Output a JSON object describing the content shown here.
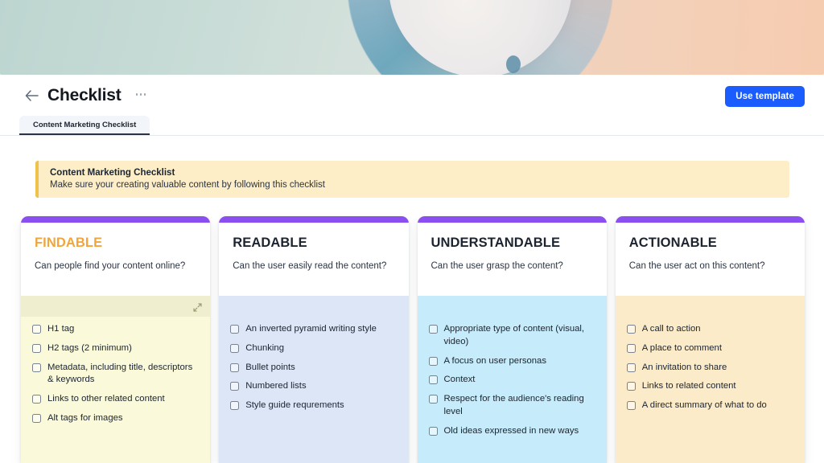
{
  "header": {
    "back_icon": "arrow-left-icon",
    "title": "Checklist",
    "more_icon": "more-horizontal-icon",
    "use_template_label": "Use template"
  },
  "tabs": [
    {
      "label": "Content Marketing Checklist",
      "active": true
    }
  ],
  "notice": {
    "title": "Content Marketing Checklist",
    "subtitle": "Make sure your creating valuable content by following this checklist",
    "background": "#FDEEC7",
    "bar_color": "#F0C14B"
  },
  "colors": {
    "card_accent": "#8B4FF0",
    "primary_button": "#1B5CFF",
    "findable_title": "#F0A63C",
    "findable_body": "#FAFADA",
    "readable_body": "#DDE6F7",
    "understandable_body": "#C6EBFA",
    "actionable_body": "#FBEBC8"
  },
  "cards": [
    {
      "title": "FINDABLE",
      "title_color": "#F0A63C",
      "question": "Can people find your content online?",
      "body_color": "#FAFADA",
      "hover_band": true,
      "resize_icon": "resize-diagonal-icon",
      "items": [
        "H1 tag",
        "H2 tags (2 minimum)",
        "Metadata, including title, descriptors & keywords",
        "Links to other related content",
        "Alt tags for images"
      ]
    },
    {
      "title": "READABLE",
      "title_color": "#1C2430",
      "question": "Can the user easily read the content?",
      "body_color": "#DDE6F7",
      "hover_band": false,
      "resize_icon": "resize-diagonal-icon",
      "items": [
        "An inverted pyramid writing style",
        "Chunking",
        "Bullet points",
        "Numbered lists",
        "Style guide requrements"
      ]
    },
    {
      "title": "UNDERSTANDABLE",
      "title_color": "#1C2430",
      "question": "Can the user grasp the content?",
      "body_color": "#C6EBFA",
      "hover_band": false,
      "resize_icon": "resize-diagonal-icon",
      "items": [
        "Appropriate type of content (visual, video)",
        "A focus on user personas",
        "Context",
        "Respect for the audience's reading level",
        "Old ideas expressed in new ways"
      ]
    },
    {
      "title": "ACTIONABLE",
      "title_color": "#1C2430",
      "question": "Can the user act on this content?",
      "body_color": "#FBEBC8",
      "hover_band": false,
      "resize_icon": "resize-diagonal-icon",
      "items": [
        "A call to action",
        "A place to comment",
        "An invitation to share",
        "Links to related content",
        "A direct summary of what to do"
      ]
    }
  ]
}
